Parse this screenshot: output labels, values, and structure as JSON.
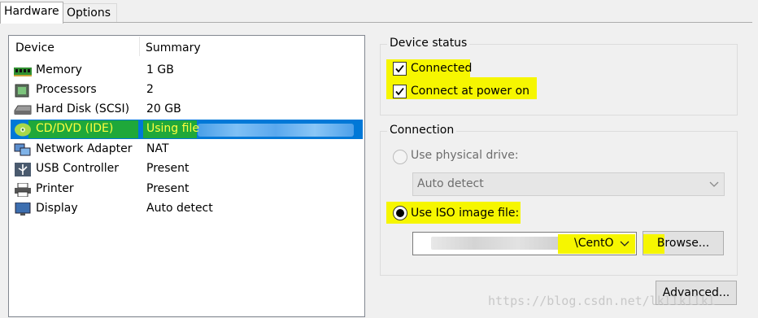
{
  "tabs": [
    {
      "label": "Hardware"
    },
    {
      "label": "Options"
    }
  ],
  "device_list": {
    "columns": {
      "device": "Device",
      "summary": "Summary"
    },
    "rows": [
      {
        "name": "Memory",
        "summary": "1 GB",
        "icon": "memory-icon"
      },
      {
        "name": "Processors",
        "summary": "2",
        "icon": "processor-icon"
      },
      {
        "name": "Hard Disk (SCSI)",
        "summary": "20 GB",
        "icon": "hard-disk-icon"
      },
      {
        "name": "CD/DVD (IDE)",
        "summary": "Using file",
        "icon": "cd-dvd-icon",
        "selected": true
      },
      {
        "name": "Network Adapter",
        "summary": "NAT",
        "icon": "network-adapter-icon"
      },
      {
        "name": "USB Controller",
        "summary": "Present",
        "icon": "usb-icon"
      },
      {
        "name": "Printer",
        "summary": "Present",
        "icon": "printer-icon"
      },
      {
        "name": "Display",
        "summary": "Auto detect",
        "icon": "display-icon"
      }
    ]
  },
  "device_status": {
    "title": "Device status",
    "connected": {
      "label": "Connected",
      "checked": true
    },
    "connect_at_power_on": {
      "label": "Connect at power on",
      "checked": true
    }
  },
  "connection": {
    "title": "Connection",
    "physical_drive": {
      "label": "Use physical drive:",
      "selected": false,
      "enabled": false
    },
    "physical_drive_select": {
      "value": "Auto detect"
    },
    "iso_image": {
      "label": "Use ISO image file:",
      "selected": true
    },
    "iso_path": {
      "value": "\\CentO"
    },
    "browse_label": "Browse..."
  },
  "advanced_label": "Advanced...",
  "watermark": "https://blog.csdn.net/lkllkllkl",
  "colors": {
    "selection": "#0078d7",
    "highlight_yellow": "#f6f600",
    "highlight_green": "#1fa83a"
  }
}
